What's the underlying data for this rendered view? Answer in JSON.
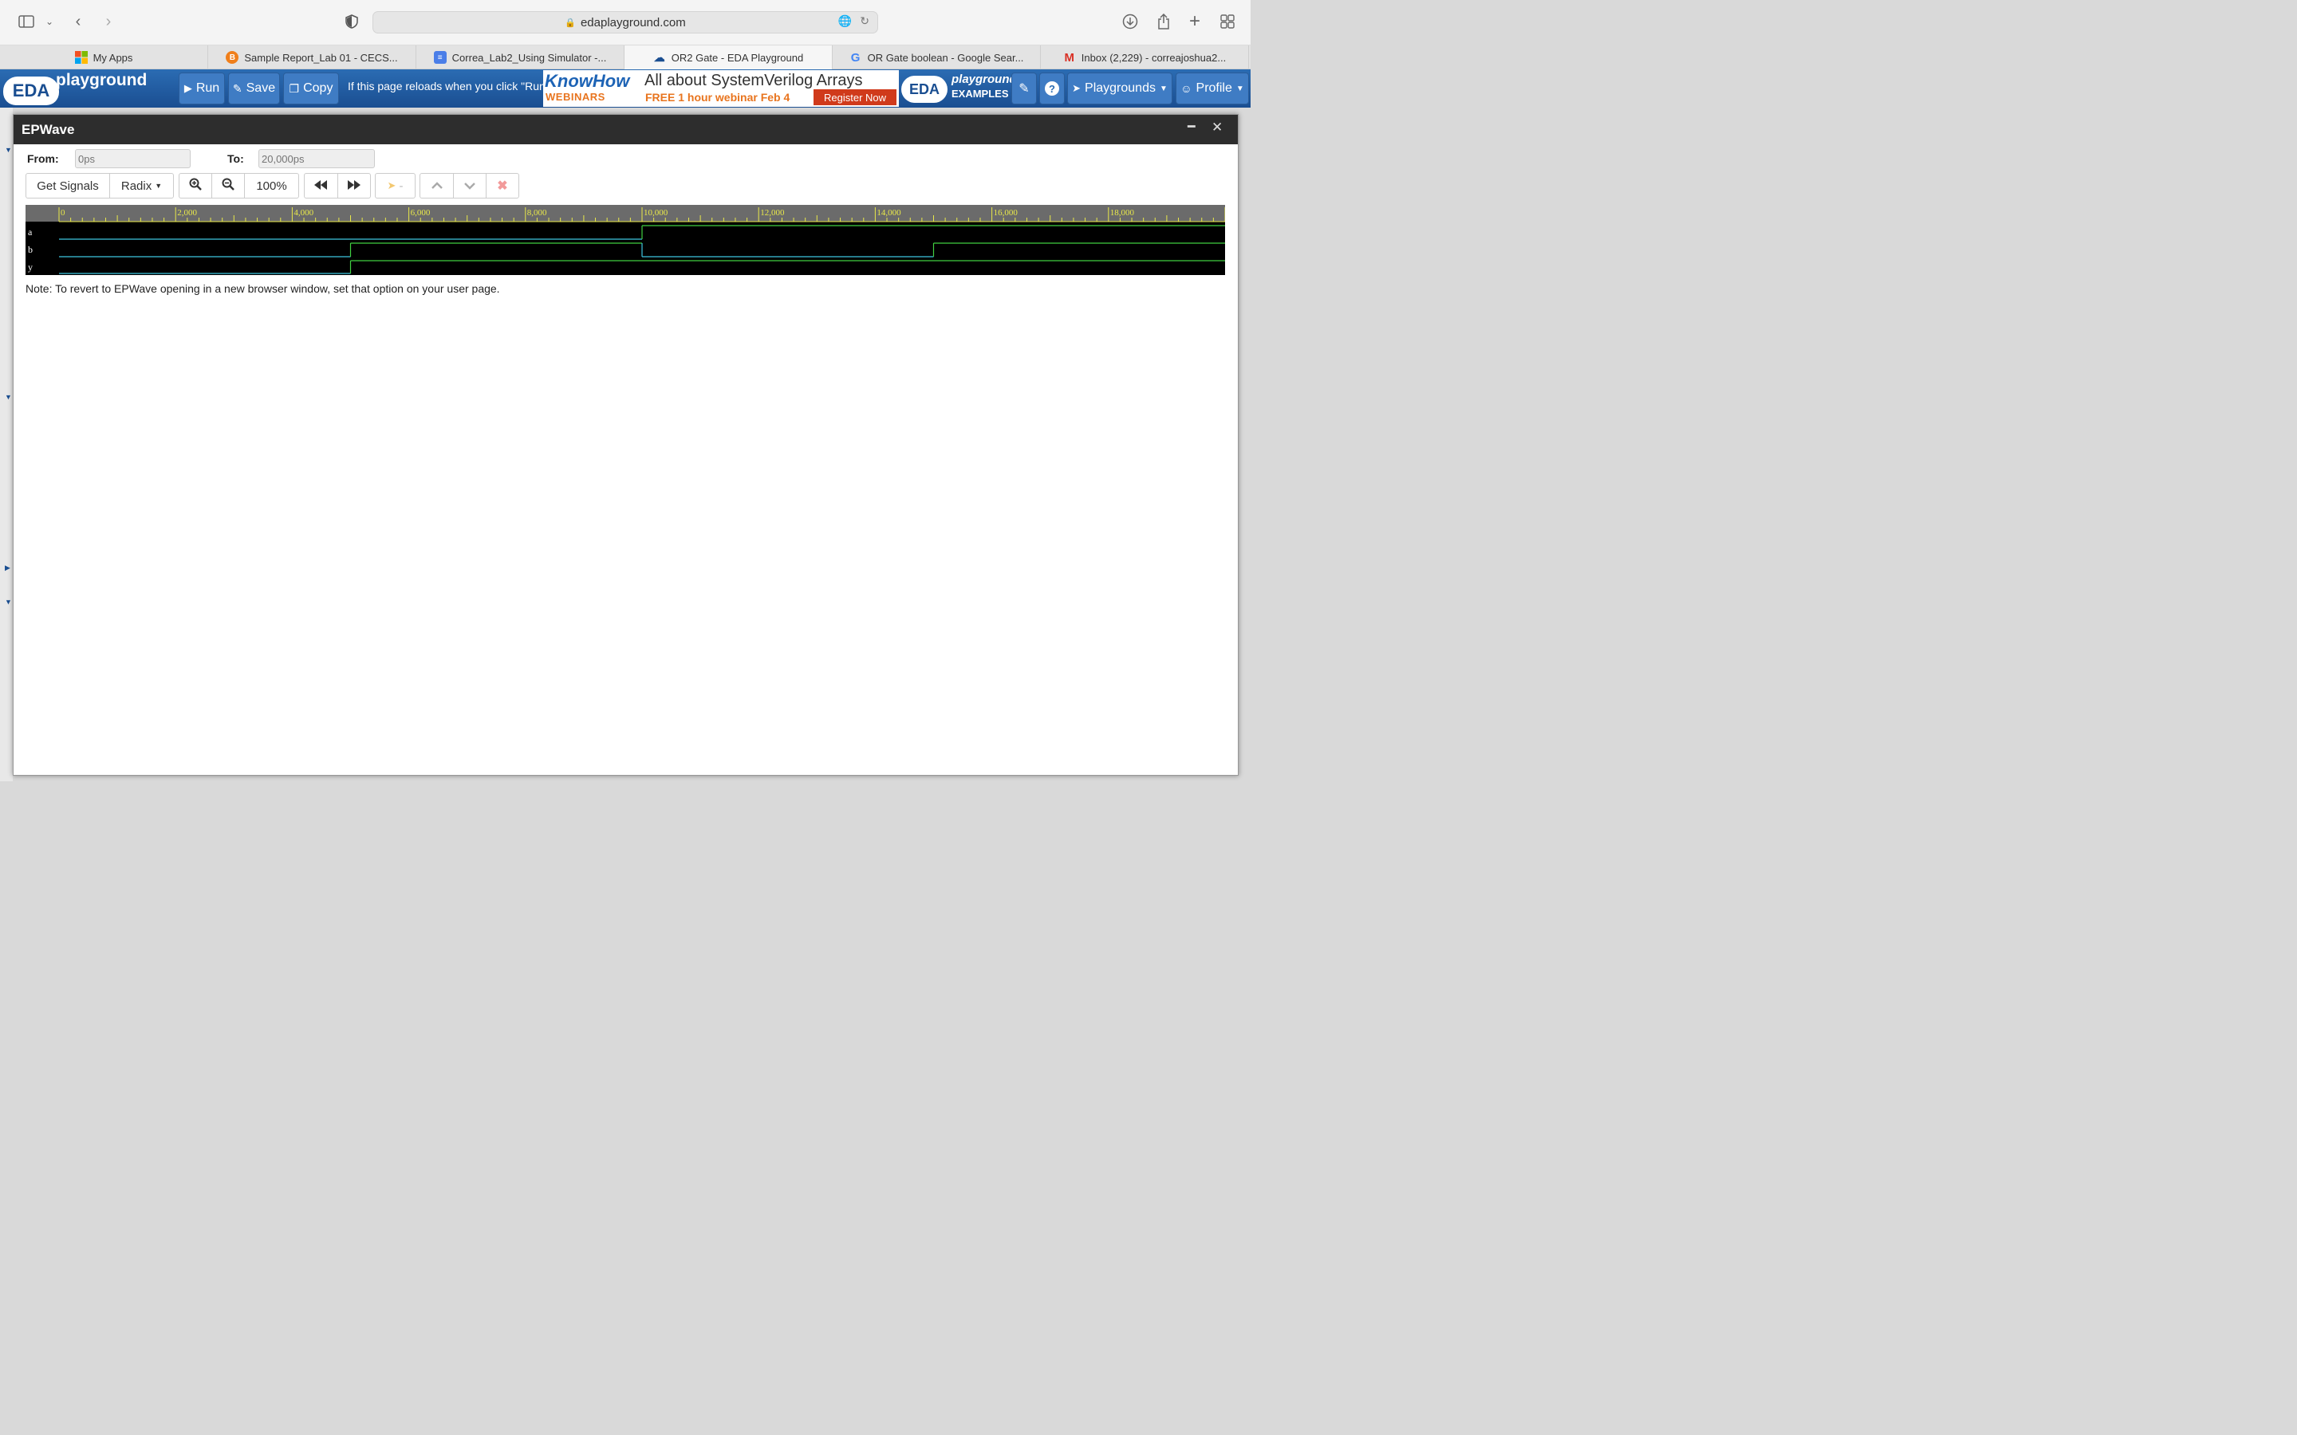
{
  "browser": {
    "url": "edaplayground.com",
    "tabs": [
      {
        "label": "My Apps",
        "icon": "ms-apps-icon",
        "color": "#e25a22"
      },
      {
        "label": "Sample Report_Lab 01 - CECS...",
        "icon": "orange-circle-icon",
        "color": "#f07f1b"
      },
      {
        "label": "Correa_Lab2_Using Simulator -...",
        "icon": "google-docs-icon",
        "color": "#4a7ee8"
      },
      {
        "label": "OR2 Gate - EDA Playground",
        "icon": "eda-cloud-icon",
        "color": "#1a4e91",
        "active": true
      },
      {
        "label": "OR Gate boolean - Google Sear...",
        "icon": "google-icon",
        "color": "#4285f4"
      },
      {
        "label": "Inbox (2,229) - correajoshua2...",
        "icon": "gmail-icon",
        "color": "#d93025"
      }
    ]
  },
  "eda_header": {
    "logo_eda": "EDA",
    "logo_word": "playground",
    "run_label": "Run",
    "save_label": "Save",
    "copy_label": "Copy",
    "message": "If this page reloads when you click \"Run\"",
    "ad": {
      "brand": "KnowHow",
      "sub": "WEBINARS",
      "title": "All about SystemVerilog Arrays",
      "detail": "FREE 1 hour webinar  Feb 4",
      "cta": "Register Now"
    },
    "examples_eda": "EDA",
    "examples_word1": "playground",
    "examples_word2": "EXAMPLES",
    "playgrounds_label": "Playgrounds",
    "profile_label": "Profile"
  },
  "epwave": {
    "title": "EPWave",
    "from_label": "From:",
    "from_placeholder": "0ps",
    "to_label": "To:",
    "to_placeholder": "20,000ps",
    "get_signals": "Get Signals",
    "radix": "Radix",
    "zoom_level": "100%",
    "marker_label": "-",
    "note": "Note: To revert to EPWave opening in a new browser window, set that option on your user page.",
    "colors": {
      "high": "#40d040",
      "low": "#3ec6e0",
      "tick": "#e8e84a",
      "ruler": "#6b6b6b"
    }
  },
  "chart_data": {
    "type": "line",
    "x_unit": "ps",
    "xlim": [
      0,
      20000
    ],
    "tick_labels": [
      "0",
      "2,000",
      "4,000",
      "6,000",
      "8,000",
      "10,000",
      "12,000",
      "14,000",
      "16,000",
      "18,000"
    ],
    "series": [
      {
        "name": "a",
        "steps": [
          [
            0,
            0
          ],
          [
            10000,
            1
          ],
          [
            20000,
            1
          ]
        ]
      },
      {
        "name": "b",
        "steps": [
          [
            0,
            0
          ],
          [
            5000,
            1
          ],
          [
            10000,
            0
          ],
          [
            15000,
            1
          ],
          [
            20000,
            1
          ]
        ]
      },
      {
        "name": "y",
        "steps": [
          [
            0,
            0
          ],
          [
            5000,
            1
          ],
          [
            20000,
            1
          ]
        ]
      }
    ]
  }
}
